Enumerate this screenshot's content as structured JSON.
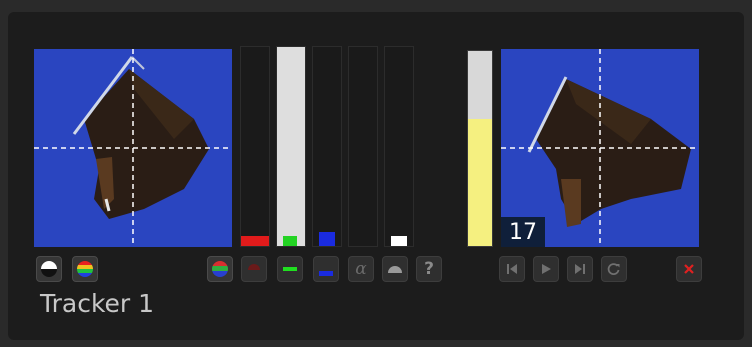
{
  "tracker": {
    "name": "Tracker 1"
  },
  "frame": {
    "number": "17"
  },
  "channels": [
    {
      "name": "red",
      "color": "#e11b1b",
      "level": 0.05
    },
    {
      "name": "green",
      "color": "#e0e0e0",
      "level": 1.0
    },
    {
      "name": "blue",
      "color": "#1a2be0",
      "level": 0.07
    },
    {
      "name": "alpha",
      "color": "#444444",
      "level": 0.0
    },
    {
      "name": "luma",
      "color": "#ffffff",
      "level": 0.05
    }
  ],
  "match_meter": {
    "color": "#f5f080",
    "level": 0.65
  },
  "colors": {
    "accent_close": "#e02020",
    "preview_blue": "#2a45c0"
  },
  "icons": {
    "luma": "half-white-circle-icon",
    "rgb": "rgb-stripe-circle-icon",
    "red": "red-arc-icon",
    "green": "green-bar-icon",
    "blue": "blue-bar-icon",
    "alpha": "alpha-icon",
    "combined": "gray-sphere-icon",
    "help": "question-icon",
    "first": "skip-first-icon",
    "play": "play-icon",
    "last": "skip-last-icon",
    "reset": "reset-icon",
    "close": "close-icon"
  },
  "buttons": {
    "alpha_glyph": "α",
    "help_glyph": "?"
  }
}
